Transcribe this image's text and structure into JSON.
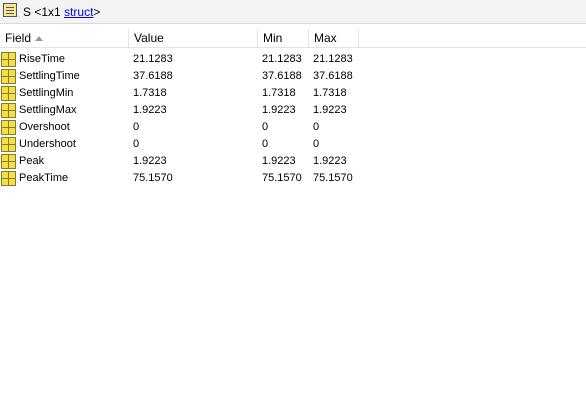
{
  "title": {
    "var_name": "S",
    "size_prefix": "<1x1",
    "class_link": "struct",
    "suffix": ">"
  },
  "columns": [
    "Field",
    "Value",
    "Min",
    "Max"
  ],
  "rows": [
    {
      "field": "RiseTime",
      "value": "21.1283",
      "min": "21.1283",
      "max": "21.1283"
    },
    {
      "field": "SettlingTime",
      "value": "37.6188",
      "min": "37.6188",
      "max": "37.6188"
    },
    {
      "field": "SettlingMin",
      "value": "1.7318",
      "min": "1.7318",
      "max": "1.7318"
    },
    {
      "field": "SettlingMax",
      "value": "1.9223",
      "min": "1.9223",
      "max": "1.9223"
    },
    {
      "field": "Overshoot",
      "value": "0",
      "min": "0",
      "max": "0"
    },
    {
      "field": "Undershoot",
      "value": "0",
      "min": "0",
      "max": "0"
    },
    {
      "field": "Peak",
      "value": "1.9223",
      "min": "1.9223",
      "max": "1.9223"
    },
    {
      "field": "PeakTime",
      "value": "75.1570",
      "min": "75.1570",
      "max": "75.1570"
    }
  ],
  "colors": {
    "link": "#0000ee",
    "field_icon_fill": "#f3df4a",
    "title_icon_fill": "#f4e79a",
    "header_border": "#e3e3e3"
  },
  "icons": {
    "title": "struct-variable-icon",
    "field": "struct-field-icon",
    "sort": "sort-ascending-icon"
  }
}
